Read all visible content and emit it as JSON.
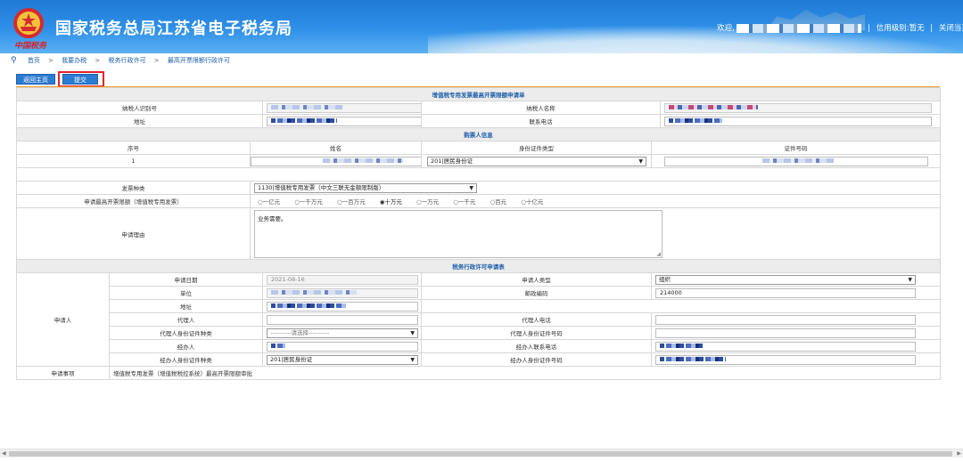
{
  "header": {
    "title": "国家税务总局江苏省电子税务局",
    "seal_text": "中国税务",
    "welcome": "欢迎,",
    "credit_label": "信用级别:",
    "credit_value": "暂无",
    "close_label": "关闭当页"
  },
  "breadcrumb": [
    "首页",
    "我要办税",
    "税务行政许可",
    "最高开票限额行政许可"
  ],
  "toolbar": {
    "home_label": "返回主页",
    "submit_label": "提交"
  },
  "form": {
    "title": "增值税专用发票最高开票限额申请单",
    "taxpayer_id_label": "纳税人识别号",
    "taxpayer_name_label": "纳税人名称",
    "address_label": "地址",
    "phone_label": "联系电话",
    "buyer_section": "购票人信息",
    "buyer_columns": [
      "序号",
      "姓名",
      "身份证件类型",
      "证件号码"
    ],
    "buyer_row": {
      "index": "1",
      "id_type": "201|居民身份证"
    },
    "invoice_type_label": "发票种类",
    "invoice_type_value": "1130|增值税专用发票（中文三联无金额限制版）",
    "limit_label": "申请最高开票限额（增值税专用发票）",
    "limit_options": [
      "一亿元",
      "一千万元",
      "一百万元",
      "十万元",
      "一万元",
      "一千元",
      "百元",
      "十亿元"
    ],
    "limit_selected": "十万元",
    "reason_label": "申请理由",
    "reason_value": "业务需要。"
  },
  "permit": {
    "title": "税务行政许可申请表",
    "applicant_label": "申请人",
    "apply_date_label": "申请日期",
    "apply_date_value": "2021-08-16",
    "applicant_type_label": "申请人类型",
    "applicant_type_value": "组织",
    "unit_label": "单位",
    "postcode_label": "邮政编码",
    "postcode_value": "214000",
    "address_label": "地址",
    "agent_label": "代理人",
    "agent_phone_label": "代理人电话",
    "agent_id_type_label": "代理人身份证件种类",
    "agent_id_type_placeholder": "----------请选择----------",
    "agent_id_no_label": "代理人身份证件号码",
    "handler_label": "经办人",
    "handler_phone_label": "经办人联系电话",
    "handler_id_type_label": "经办人身份证件种类",
    "handler_id_type_value": "201|居民身份证",
    "handler_id_no_label": "经办人身份证件号码",
    "matter_label": "申请事项",
    "matter_value": "增值税专用发票（增值税税控系统）最高开票限额审批"
  }
}
